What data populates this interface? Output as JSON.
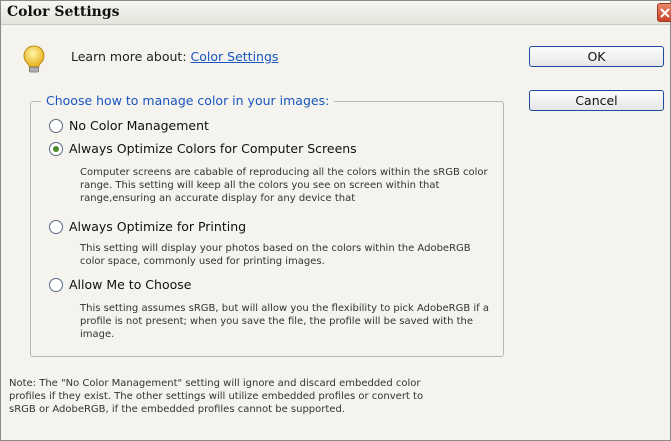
{
  "window": {
    "title": "Color Settings"
  },
  "learn_more": {
    "label": "Learn more about:",
    "link": "Color Settings"
  },
  "buttons": {
    "ok": "OK",
    "cancel": "Cancel"
  },
  "group": {
    "legend": "Choose how to manage color in your images:",
    "options": [
      {
        "label": "No Color Management",
        "selected": false,
        "description": ""
      },
      {
        "label": "Always Optimize Colors for Computer Screens",
        "selected": true,
        "description": "Computer screens are cabable of reproducing all the colors within the sRGB color range. This setting will keep all the colors you see on screen within that range,ensuring an accurate display for any device that"
      },
      {
        "label": "Always Optimize for Printing",
        "selected": false,
        "description": "This setting will display your photos based on the colors within the AdobeRGB color space, commonly used for printing images."
      },
      {
        "label": "Allow Me to Choose",
        "selected": false,
        "description": "This setting assumes sRGB, but will allow you the flexibility to pick AdobeRGB if a profile is not present; when you save the file, the profile will be saved with the image."
      }
    ]
  },
  "note": "Note: The \"No Color Management\" setting will ignore and discard embedded color profiles if they exist. The other settings will utilize embedded profiles or convert to sRGB or AdobeRGB, if the embedded profiles cannot be supported.",
  "icons": {
    "tip": "lightbulb-icon",
    "close": "close-icon"
  },
  "colors": {
    "accent": "#1a55c0",
    "radio_selected": "#4a8c2a",
    "close_button": "#c9432a"
  }
}
